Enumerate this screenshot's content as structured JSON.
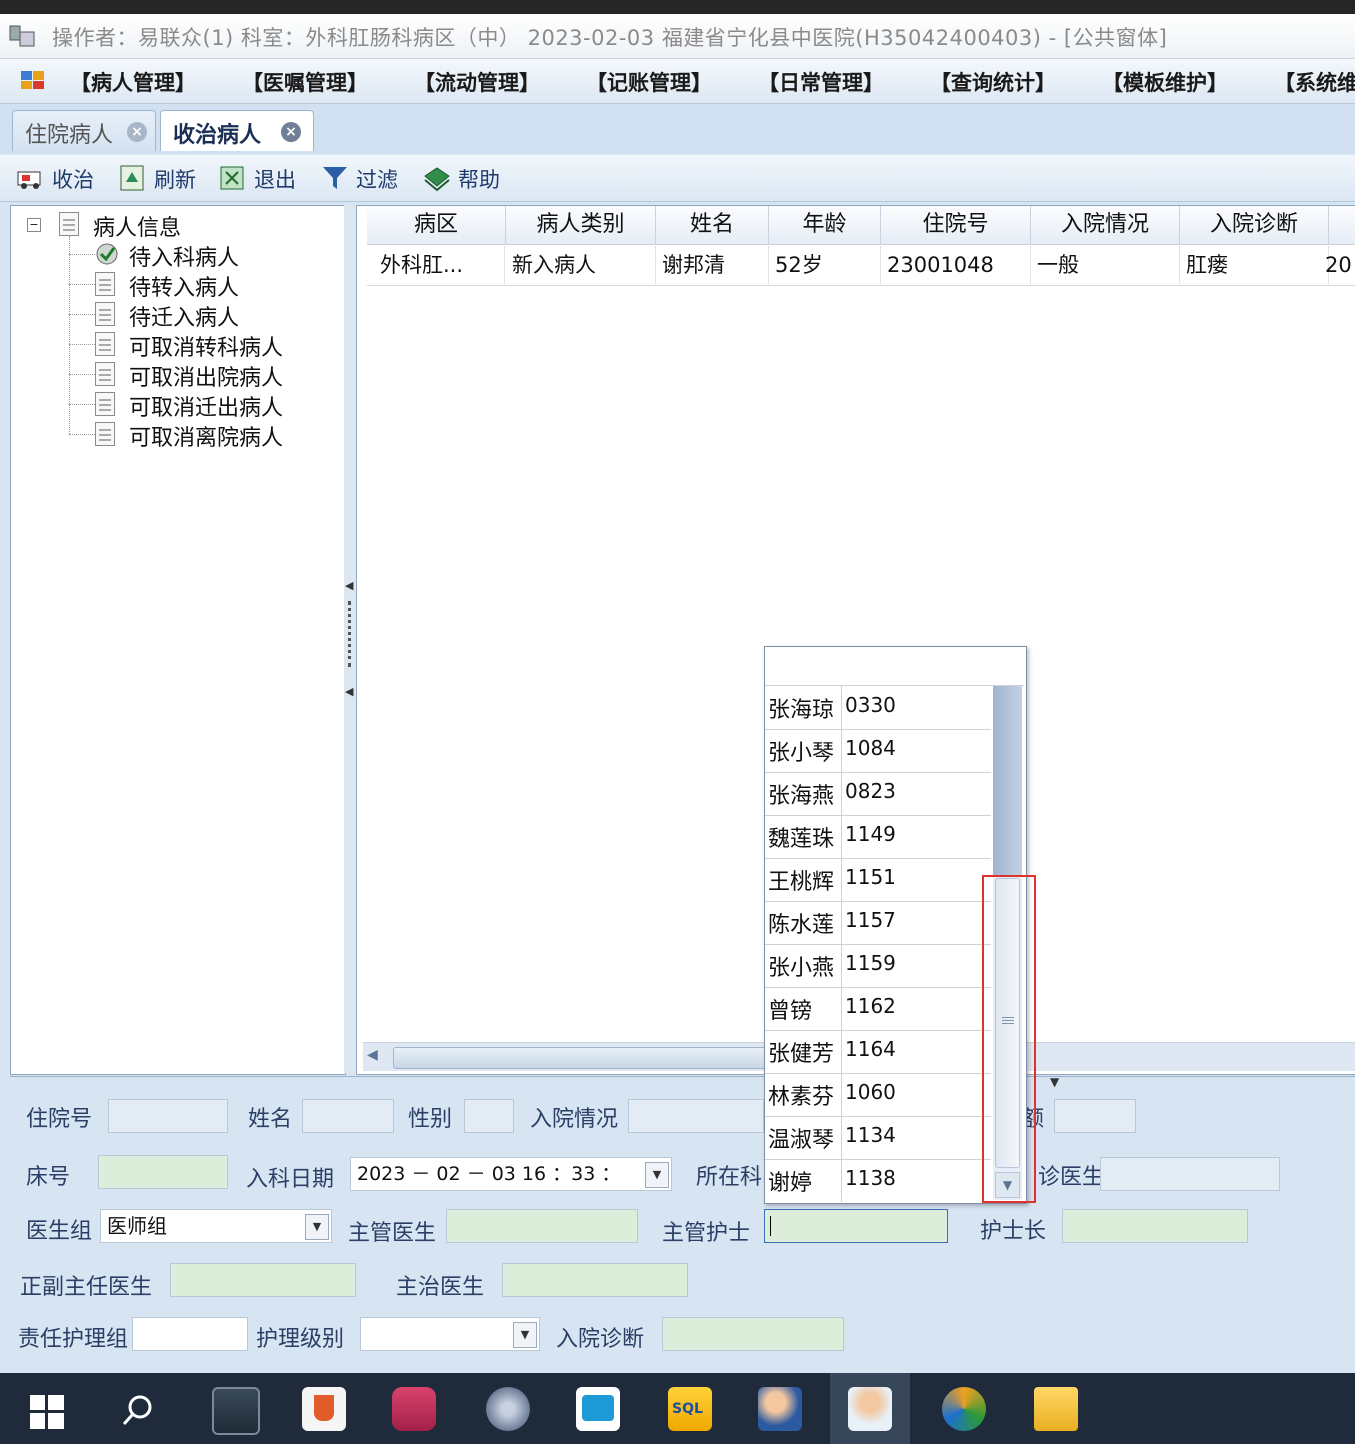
{
  "window": {
    "title": "操作者：易联众(1)  科室：外科肛肠科病区（中）  2023-02-03  福建省宁化县中医院(H35042400403) - [公共窗体]"
  },
  "menu": {
    "items": [
      "【病人管理】",
      "【医嘱管理】",
      "【流动管理】",
      "【记账管理】",
      "【日常管理】",
      "【查询统计】",
      "【模板维护】",
      "【系统维"
    ]
  },
  "tabs": [
    {
      "label": "住院病人",
      "active": false
    },
    {
      "label": "收治病人",
      "active": true
    }
  ],
  "toolbar": {
    "admit": "收治",
    "refresh": "刷新",
    "exit": "退出",
    "filter": "过滤",
    "help": "帮助"
  },
  "tree": {
    "root": "病人信息",
    "children": [
      "待入科病人",
      "待转入病人",
      "待迁入病人",
      "可取消转科病人",
      "可取消出院病人",
      "可取消迁出病人",
      "可取消离院病人"
    ]
  },
  "grid": {
    "columns": [
      "病区",
      "病人类别",
      "姓名",
      "年龄",
      "住院号",
      "入院情况",
      "入院诊断",
      ""
    ],
    "rows": [
      [
        "外科肛...",
        "新入病人",
        "谢邦清",
        "52岁",
        "23001048",
        "一般",
        "肛瘘",
        "20"
      ]
    ]
  },
  "form": {
    "inpatient_no_label": "住院号",
    "name_label": "姓名",
    "gender_label": "性别",
    "admit_status_label": "入院情况",
    "amount_label_partial": "额",
    "bed_label": "床号",
    "admit_date_label": "入科日期",
    "admit_date_value": "2023 － 02 － 03     16  ：33  ：",
    "dept_label": "所在科",
    "outpatient_doctor_label_partial": "诊医生",
    "doctor_group_label": "医生组",
    "doctor_group_value": "医师组",
    "attending_label": "主管医生",
    "charge_nurse_label": "主管护士",
    "head_nurse_label": "护士长",
    "chief_label": "正副主任医生",
    "treating_label": "主治医生",
    "nursing_group_label": "责任护理组",
    "nursing_level_label": "护理级别",
    "admit_diag_label": "入院诊断"
  },
  "popup": {
    "items": [
      {
        "name": "张海琼",
        "code": "0330"
      },
      {
        "name": "张小琴",
        "code": "1084"
      },
      {
        "name": "张海燕",
        "code": "0823"
      },
      {
        "name": "魏莲珠",
        "code": "1149"
      },
      {
        "name": "王桃辉",
        "code": "1151"
      },
      {
        "name": "陈水莲",
        "code": "1157"
      },
      {
        "name": "张小燕",
        "code": "1159"
      },
      {
        "name": "曾镑",
        "code": "1162"
      },
      {
        "name": "张健芳",
        "code": "1164"
      },
      {
        "name": "林素芬",
        "code": "1060"
      },
      {
        "name": "温淑琴",
        "code": "1134"
      },
      {
        "name": "谢婷",
        "code": "1138"
      }
    ]
  },
  "colors": {
    "highlight": "#e0322c",
    "input_green": "#dcedd9",
    "panel_blue": "#d7e5f3"
  }
}
